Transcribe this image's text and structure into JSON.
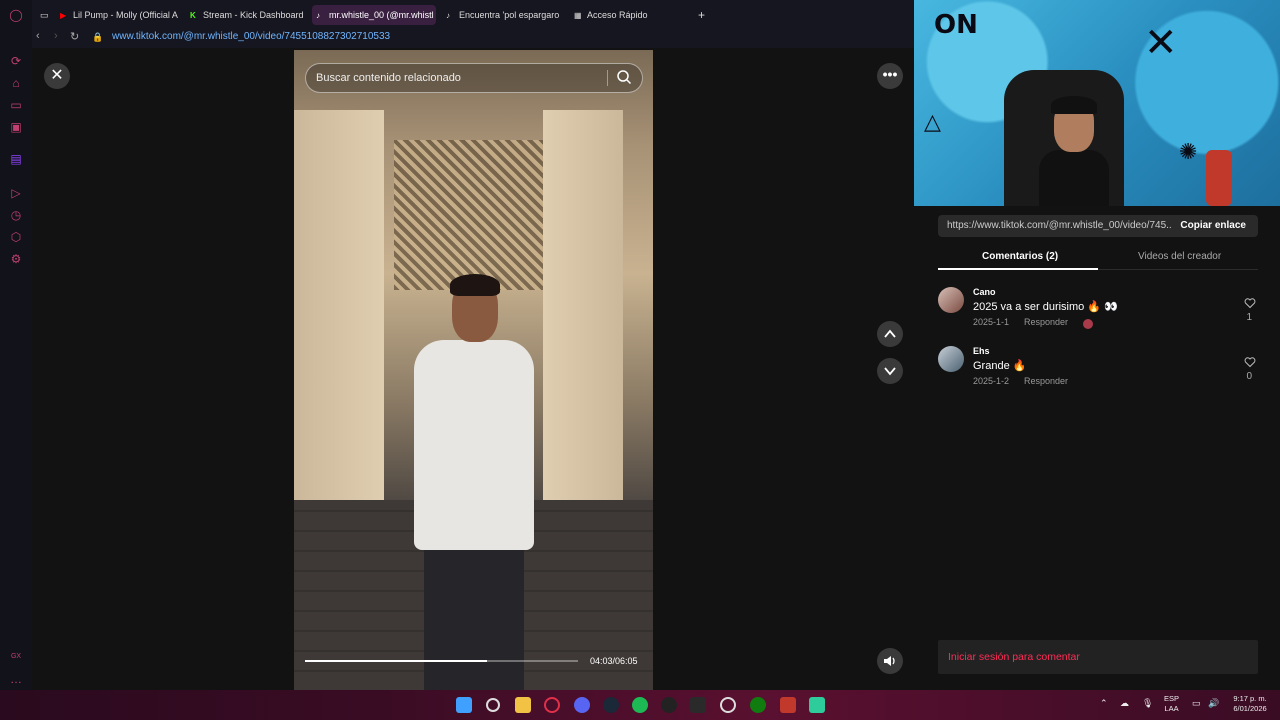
{
  "browser": {
    "tabs": [
      {
        "label": "Lil Pump - Molly (Official A",
        "icon": "youtube-icon",
        "color": "#ff0000"
      },
      {
        "label": "Stream - Kick Dashboard",
        "icon": "kick-icon",
        "color": "#53fc18"
      },
      {
        "label": "mr.whistle_00 (@mr.whistl",
        "icon": "tiktok-icon",
        "color": "#ffffff"
      },
      {
        "label": "Encuentra 'pol espargaro",
        "icon": "tiktok-icon",
        "color": "#ffffff"
      },
      {
        "label": "Acceso Rápido",
        "icon": "grid-icon",
        "color": "#cccccc"
      }
    ],
    "url_host": "www.tiktok.com",
    "url_path": "/@mr.whistle_00/video/7455108827302710533"
  },
  "video": {
    "search_placeholder": "Buscar contenido relacionado",
    "progress": 0.665,
    "time": "04:03/06:05"
  },
  "panel": {
    "link": "https://www.tiktok.com/@mr.whistle_00/video/745...",
    "copy_label": "Copiar enlace",
    "tabs": [
      "Comentarios (2)",
      "Videos del creador"
    ],
    "comments": [
      {
        "user": "Cano",
        "text": "2025 va a ser durisimo 🔥 👀",
        "date": "2025-1-1",
        "reply": "Responder",
        "likes": "1"
      },
      {
        "user": "Ehs",
        "text": "Grande 🔥",
        "date": "2025-1-2",
        "reply": "Responder",
        "likes": "0"
      }
    ],
    "login_label": "Iniciar sesión para comentar"
  },
  "taskbar": {
    "lang": "ESP",
    "lang2": "LAA",
    "time": "9:17 p. m.",
    "date": "6/01/2026"
  },
  "colors": {
    "accent": "#fe2c55",
    "url": "#6fb6ff"
  }
}
